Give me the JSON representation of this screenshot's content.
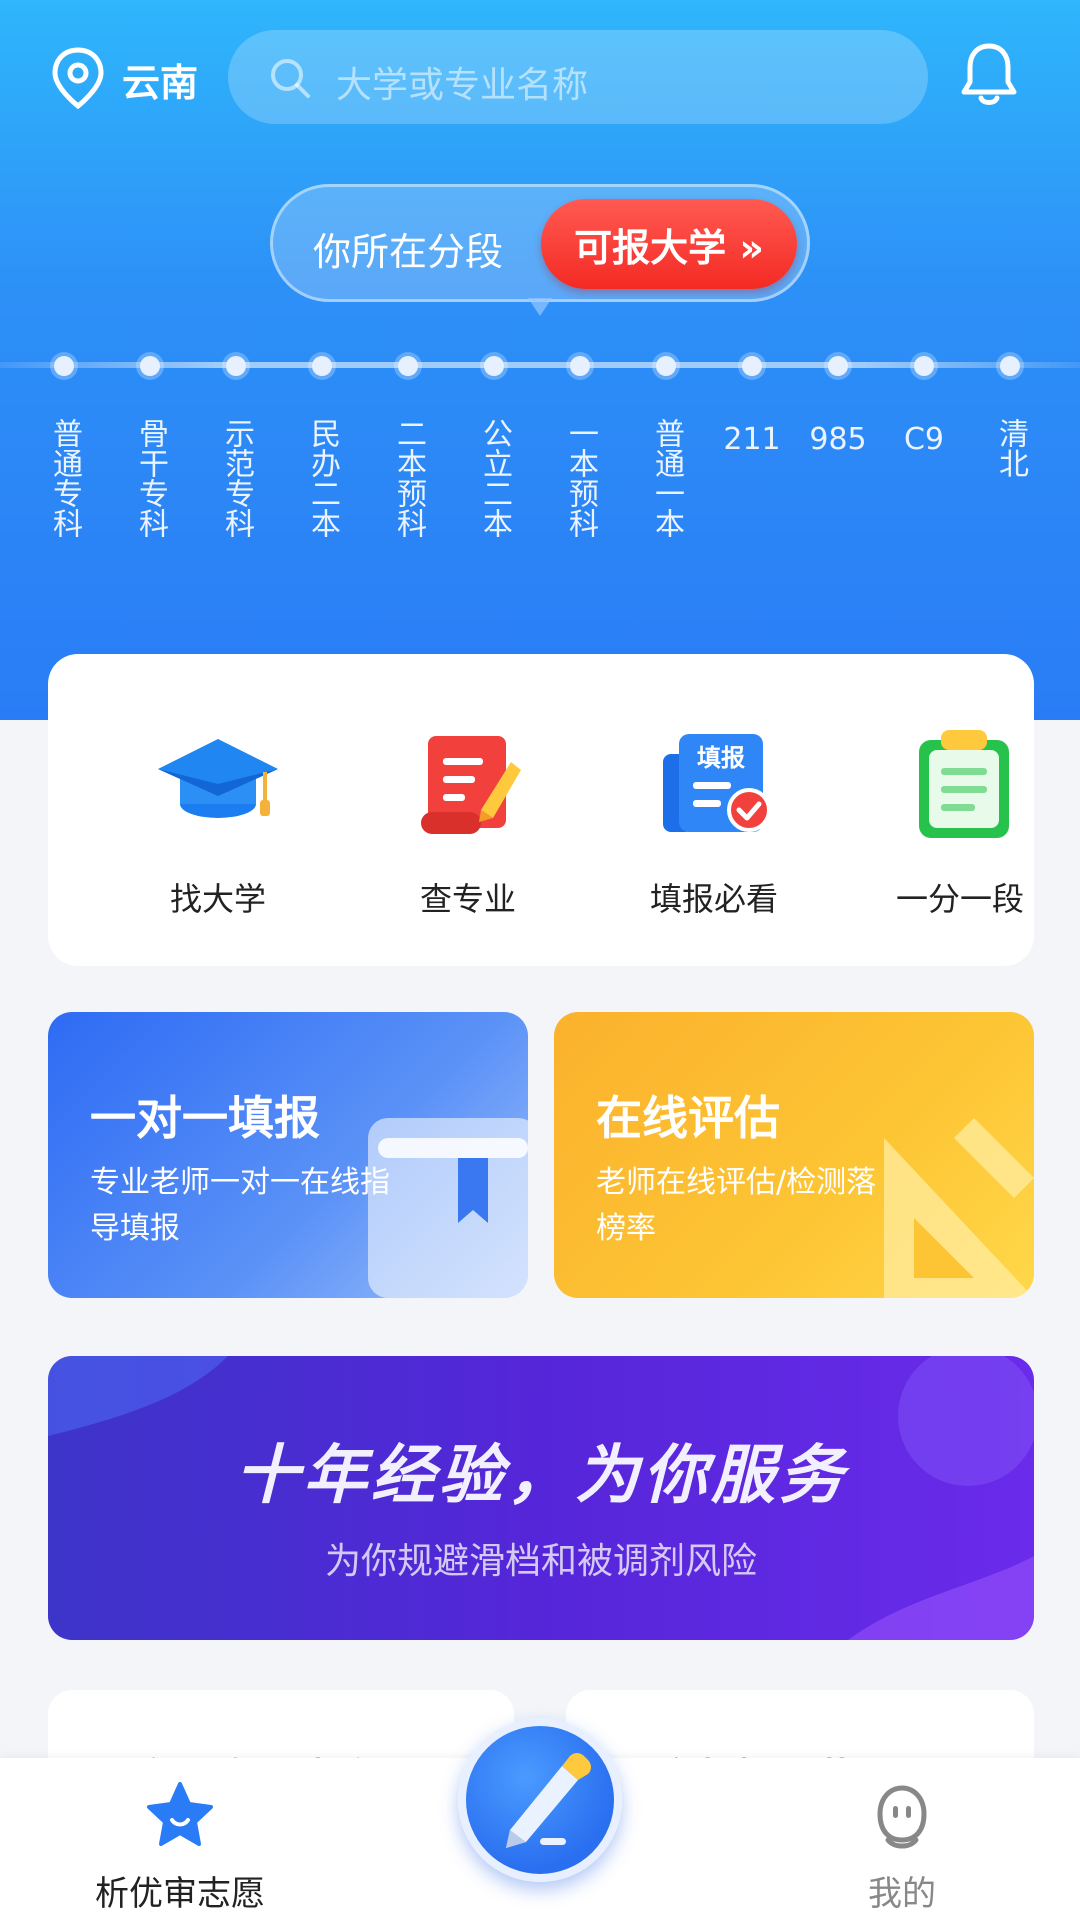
{
  "header": {
    "location": "云南",
    "search_placeholder": "大学或专业名称"
  },
  "score_range": {
    "label": "你所在分段",
    "button": "可报大学 »"
  },
  "tiers": [
    "普通专科",
    "骨干专科",
    "示范专科",
    "民办二本",
    "二本预科",
    "公立二本",
    "一本预科",
    "普通一本",
    "211",
    "985",
    "C9",
    "清北"
  ],
  "quick_actions": [
    {
      "label": "找大学",
      "icon": "graduation-cap-icon"
    },
    {
      "label": "查专业",
      "icon": "scroll-pen-icon"
    },
    {
      "label": "填报必看",
      "icon": "form-check-icon",
      "badge": "填报"
    },
    {
      "label": "一分一段",
      "icon": "clipboard-icon"
    }
  ],
  "promo_cards": [
    {
      "title": "一对一填报",
      "subtitle": "专业老师一对一在线指导填报",
      "color": "#2d6bf4"
    },
    {
      "title": "在线评估",
      "subtitle": "老师在线评估/检测落榜率",
      "color": "#fbb12d"
    }
  ],
  "banner": {
    "title": "十年经验，为你服务",
    "subtitle": "为你规避滑档和被调剂风险"
  },
  "peek_cards": [
    "公务员专业查询",
    "高数据下载"
  ],
  "tabbar": {
    "home_label": "析优审志愿",
    "me_label": "我的"
  },
  "colors": {
    "accent": "#2d90f7",
    "cta_red": "#f42a24",
    "home_active": "#2a7cf6",
    "inactive": "#888888"
  }
}
